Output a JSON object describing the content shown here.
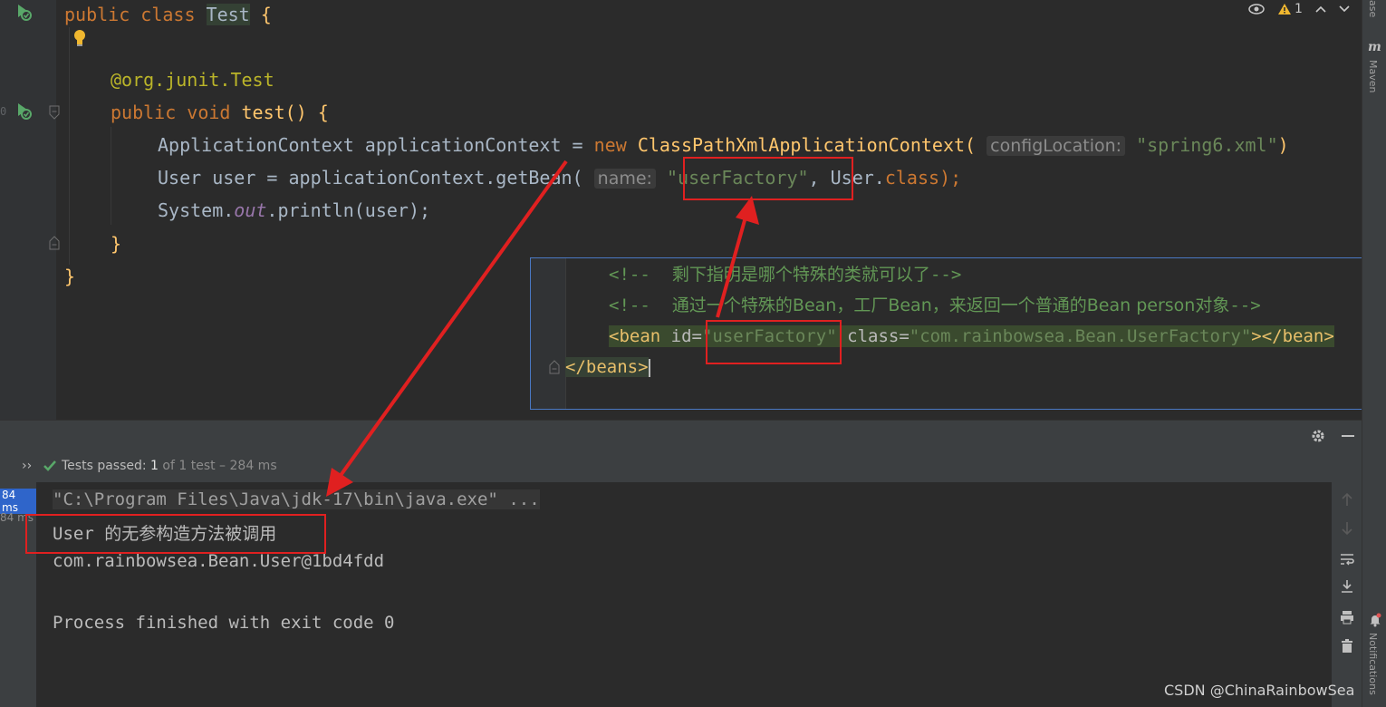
{
  "editor": {
    "line_numbers": [
      "",
      "",
      "",
      "",
      "0",
      "",
      "",
      "",
      "",
      "",
      ""
    ],
    "lines": {
      "l1_kw": "public class ",
      "l1_cls": "Test",
      "l1_brace": " {",
      "l2_ann": "@org.junit.",
      "l2_ann2": "Test",
      "l3_kw": "public void ",
      "l3_fn": "test",
      "l3_rest": "() {",
      "l4_a": "ApplicationContext applicationContext = ",
      "l4_kw": "new ",
      "l4_b": "ClassPathXmlApplicationContext(",
      "l4_hint": "configLocation:",
      "l4_str": "\"spring6.xml\"",
      "l4_end": ")",
      "l5_a": "User user = applicationContext.getBean(",
      "l5_hint": "name:",
      "l5_str": "\"userFactory\"",
      "l5_b": ", User.",
      "l5_kw": "class",
      "l5_end": ");",
      "l6_a": "System.",
      "l6_out": "out",
      "l6_b": ".println(user);",
      "l7": "}",
      "l8": "}"
    }
  },
  "inspection": {
    "warning_count": "1"
  },
  "right_strip": {
    "top_label": "ase",
    "maven_label": "Maven",
    "notifications_label": "Notifications"
  },
  "xml_popup": {
    "c1_open": "<!--",
    "c1_text": "    剩下指明是哪个特殊的类就可以了",
    "c1_close": "-->",
    "c2_open": "<!--",
    "c2_text": "    通过一个特殊的Bean，工厂Bean，来返回一个普通的Bean person对象",
    "c2_close": "-->",
    "b_open": "<bean ",
    "b_id_attr": "id=",
    "b_id_val": "\"userFactory\"",
    "b_class_attr": " class=",
    "b_class_val": "\"com.rainbowsea.Bean.UserFactory\"",
    "b_close": "></bean>",
    "beans_close": "</beans>"
  },
  "test_status": {
    "expand": "››",
    "label": "Tests passed: ",
    "count": "1",
    "detail": " of 1 test – 284 ms"
  },
  "test_tree": {
    "time1": "84 ms",
    "time2": "84 ms"
  },
  "console": {
    "lines": [
      "\"C:\\Program Files\\Java\\jdk-17\\bin\\java.exe\" ...",
      "User 的无参构造方法被调用",
      "com.rainbowsea.Bean.User@1bd4fdd",
      "",
      "Process finished with exit code 0"
    ]
  },
  "watermark": "CSDN @ChinaRainbowSea",
  "colors": {
    "accent_red": "#e02020",
    "success_green": "#59a869",
    "popup_border": "#4a78c2"
  }
}
